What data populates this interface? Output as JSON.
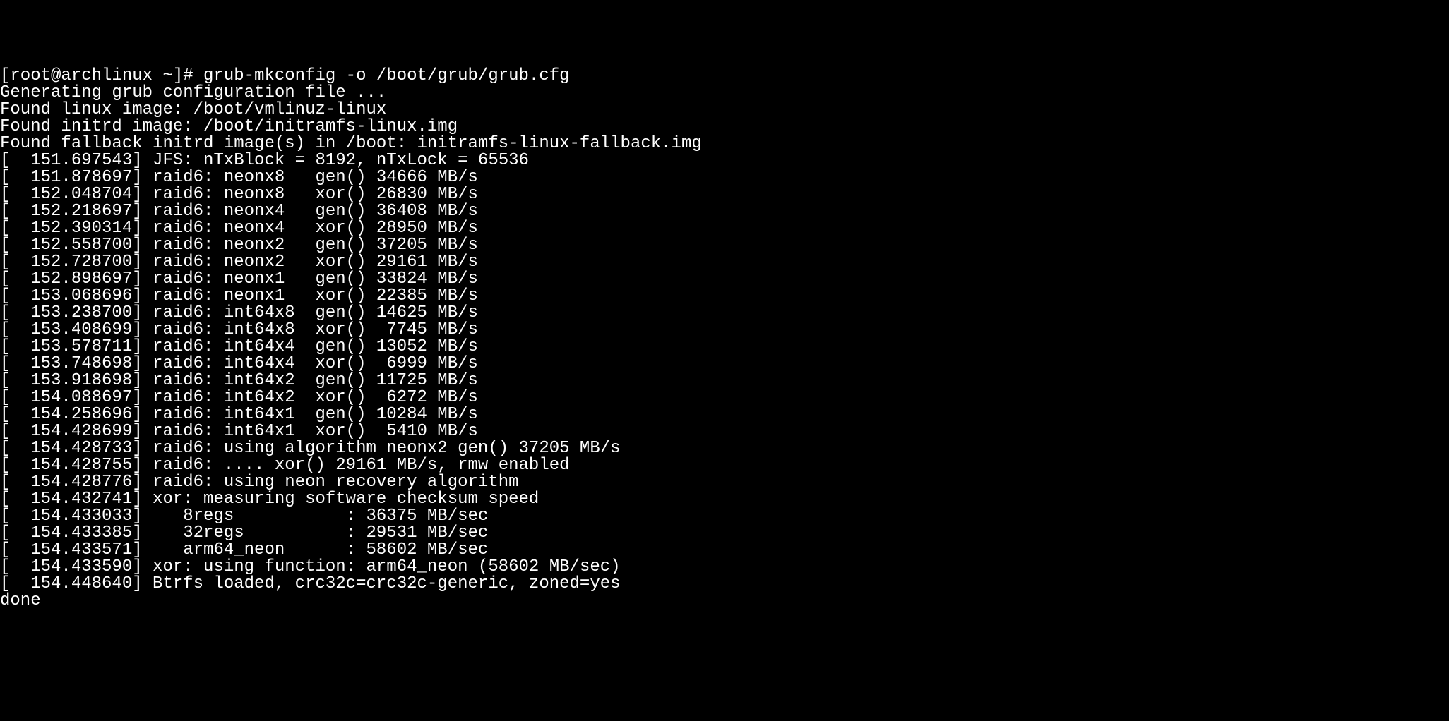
{
  "terminal": {
    "prompt": "[root@archlinux ~]# ",
    "command": "grub-mkconfig -o /boot/grub/grub.cfg",
    "output": [
      "Generating grub configuration file ...",
      "Found linux image: /boot/vmlinuz-linux",
      "Found initrd image: /boot/initramfs-linux.img",
      "Found fallback initrd image(s) in /boot: initramfs-linux-fallback.img",
      "[  151.697543] JFS: nTxBlock = 8192, nTxLock = 65536",
      "[  151.878697] raid6: neonx8   gen() 34666 MB/s",
      "[  152.048704] raid6: neonx8   xor() 26830 MB/s",
      "[  152.218697] raid6: neonx4   gen() 36408 MB/s",
      "[  152.390314] raid6: neonx4   xor() 28950 MB/s",
      "[  152.558700] raid6: neonx2   gen() 37205 MB/s",
      "[  152.728700] raid6: neonx2   xor() 29161 MB/s",
      "[  152.898697] raid6: neonx1   gen() 33824 MB/s",
      "[  153.068696] raid6: neonx1   xor() 22385 MB/s",
      "[  153.238700] raid6: int64x8  gen() 14625 MB/s",
      "[  153.408699] raid6: int64x8  xor()  7745 MB/s",
      "[  153.578711] raid6: int64x4  gen() 13052 MB/s",
      "[  153.748698] raid6: int64x4  xor()  6999 MB/s",
      "[  153.918698] raid6: int64x2  gen() 11725 MB/s",
      "[  154.088697] raid6: int64x2  xor()  6272 MB/s",
      "[  154.258696] raid6: int64x1  gen() 10284 MB/s",
      "[  154.428699] raid6: int64x1  xor()  5410 MB/s",
      "[  154.428733] raid6: using algorithm neonx2 gen() 37205 MB/s",
      "[  154.428755] raid6: .... xor() 29161 MB/s, rmw enabled",
      "[  154.428776] raid6: using neon recovery algorithm",
      "[  154.432741] xor: measuring software checksum speed",
      "[  154.433033]    8regs           : 36375 MB/sec",
      "[  154.433385]    32regs          : 29531 MB/sec",
      "[  154.433571]    arm64_neon      : 58602 MB/sec",
      "[  154.433590] xor: using function: arm64_neon (58602 MB/sec)",
      "[  154.448640] Btrfs loaded, crc32c=crc32c-generic, zoned=yes",
      "done"
    ]
  }
}
